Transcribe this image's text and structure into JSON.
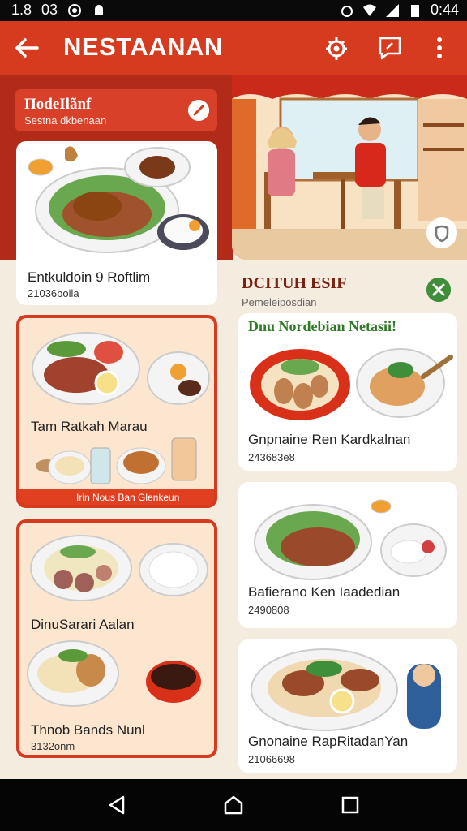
{
  "status_bar": {
    "time_left": "1.8",
    "number": "03",
    "clock": "0:44"
  },
  "app_bar": {
    "title": "NESTAANAN"
  },
  "promo": {
    "title": "ПodeIlãnf",
    "subtitle": "Sestna dkbenaan"
  },
  "hero_section": {
    "title": "DCITUH ESIF",
    "subtitle": "Pemeleiposdian"
  },
  "left_cards": [
    {
      "name": "Entkuldoin 9 Roftlim",
      "price": "21036boila"
    },
    {
      "name": "Tam Ratkah Marau",
      "caption": "Irin Nous Ban Glenkeun"
    },
    {
      "name": "DinuSarari Aalan",
      "name2": "Thnob Bands Nunl",
      "price2": "3132onm"
    }
  ],
  "right_cards": [
    {
      "banner": "Dnu Nordebian Netasii!",
      "name": "Gnpnaine Ren Kardkalnan",
      "price": "243683e8"
    },
    {
      "name": "Bafierano Ken Iaadedian",
      "price": "2490808"
    },
    {
      "name": "Gnonaine RapRitadanYan",
      "price": "21066698"
    }
  ],
  "colors": {
    "accent": "#d63a1f",
    "dark_red": "#b22a18",
    "green": "#3f8f3a"
  }
}
